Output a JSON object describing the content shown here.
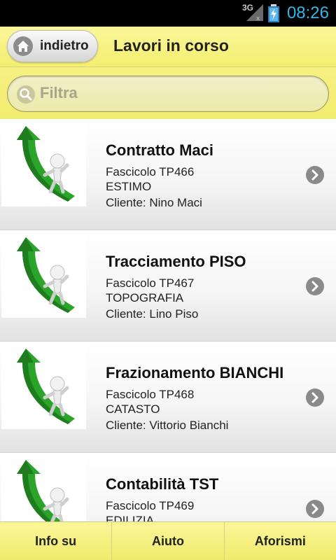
{
  "statusbar": {
    "network": "3G",
    "time": "08:26"
  },
  "header": {
    "back_label": "indietro",
    "title": "Lavori in corso"
  },
  "search": {
    "placeholder": "Filtra"
  },
  "items": [
    {
      "name": "Contratto Maci",
      "file": "Fascicolo TP466",
      "category": "ESTIMO",
      "client": "Cliente: Nino Maci"
    },
    {
      "name": "Tracciamento PISO",
      "file": "Fascicolo TP467",
      "category": "TOPOGRAFIA",
      "client": "Cliente: Lino Piso"
    },
    {
      "name": "Frazionamento BIANCHI",
      "file": "Fascicolo TP468",
      "category": "CATASTO",
      "client": "Cliente: Vittorio Bianchi"
    },
    {
      "name": "Contabilità TST",
      "file": "Fascicolo TP469",
      "category": "EDILIZIA",
      "client": ""
    }
  ],
  "footer": {
    "tabs": [
      "Info su",
      "Aiuto",
      "Aforismi"
    ]
  },
  "colors": {
    "accent_yellow": "#f4ee70",
    "clock_blue": "#33b5e5",
    "arrow_green": "#2aa52a"
  }
}
